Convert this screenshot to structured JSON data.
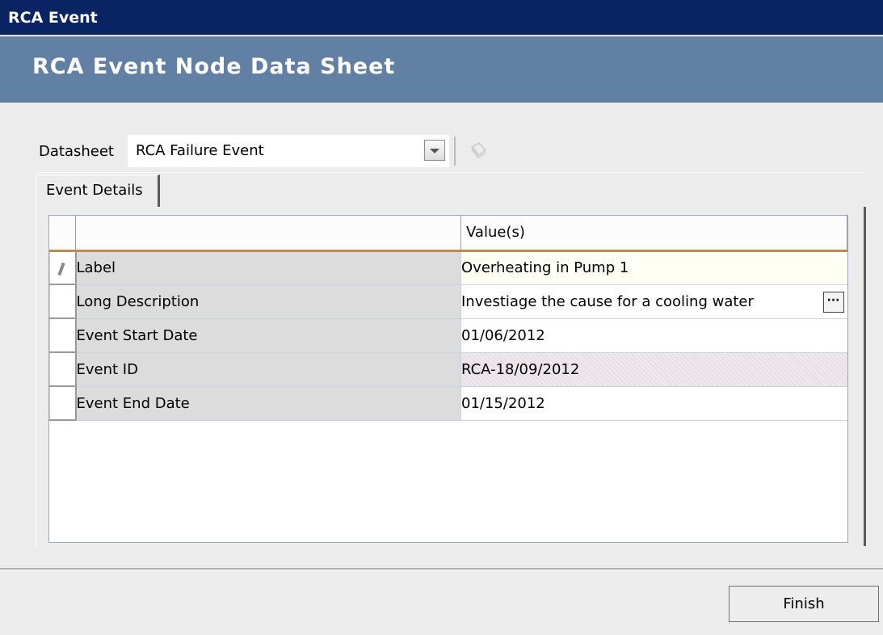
{
  "window": {
    "title": "RCA Event"
  },
  "banner": {
    "title": "RCA Event Node Data Sheet"
  },
  "datasheet": {
    "label": "Datasheet",
    "selected": "RCA Failure Event",
    "icons": {
      "dropdown": "chevron-down-icon",
      "action": "document-icon"
    }
  },
  "tabs": [
    {
      "label": "Event Details"
    }
  ],
  "grid": {
    "columns": [
      "",
      "Value(s)"
    ],
    "rows": [
      {
        "name": "Label",
        "value": "Overheating in Pump 1"
      },
      {
        "name": "Long Description",
        "value": "Investiage the cause for a cooling water"
      },
      {
        "name": "Event Start Date",
        "value": "01/06/2012"
      },
      {
        "name": "Event ID",
        "value": "RCA-18/09/2012"
      },
      {
        "name": "Event End Date",
        "value": "01/15/2012"
      }
    ]
  },
  "footer": {
    "finish_label": "Finish"
  },
  "colors": {
    "title_bar": "#0a2463",
    "banner": "#627fa4",
    "header_underline": "#c08a4a"
  }
}
